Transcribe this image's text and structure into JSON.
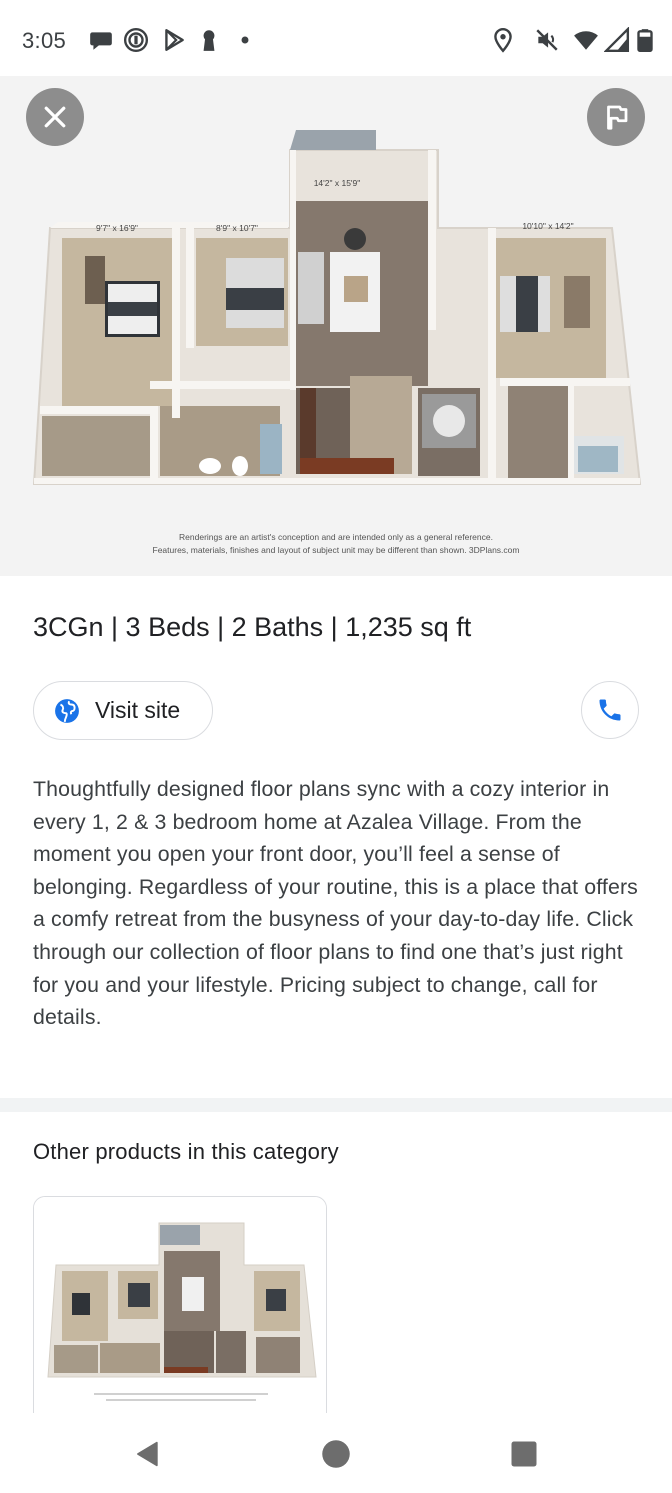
{
  "status_bar": {
    "time": "3:05",
    "left_icons": [
      "chat-bubble-icon",
      "target-ring-icon",
      "play-store-icon",
      "keyhole-icon",
      "dot-icon"
    ],
    "right_icons": [
      "location-icon",
      "mute-icon",
      "wifi-icon",
      "signal-icon",
      "battery-icon"
    ]
  },
  "hero": {
    "close_icon": "close-icon",
    "flag_icon": "flag-icon",
    "dimensions": [
      "9'7\" x 16'9\"",
      "8'9\" x 10'7\"",
      "14'2\" x 15'9\"",
      "10'10\" x 14'2\""
    ],
    "caption_line1": "Renderings are an artist's conception and are intended only as a general reference.",
    "caption_line2": "Features, materials, finishes and layout of subject unit may be different than shown. 3DPlans.com"
  },
  "product": {
    "title": "3CGn | 3 Beds | 2 Baths | 1,235 sq ft",
    "visit_site_label": "Visit site",
    "visit_icon": "globe-icon",
    "call_icon": "phone-icon",
    "description": "Thoughtfully designed floor plans sync with a cozy interior in every 1, 2 & 3 bedroom home at Azalea Village. From the moment you open your front door, you’ll feel a sense of belonging. Regardless of your routine, this is a place that offers a comfy retreat from the busyness of your day-to-day life. Click through our collection of floor plans to find one that’s just right for you and your lifestyle. Pricing subject to change, call for details."
  },
  "other_products": {
    "title": "Other products in this category"
  },
  "colors": {
    "accent_blue": "#1a73e8",
    "overlay_gray": "#8d8d8d",
    "divider": "#f1f3f4"
  },
  "nav_bar": {
    "icons": [
      "back-icon",
      "home-icon",
      "recents-icon"
    ]
  }
}
